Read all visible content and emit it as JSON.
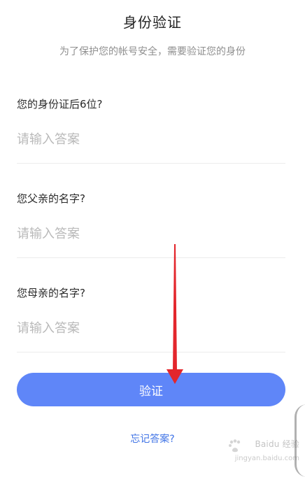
{
  "page": {
    "title": "身份验证",
    "subtitle": "为了保护您的帐号安全，需要验证您的身份"
  },
  "questions": [
    {
      "label": "您的身份证后6位?",
      "placeholder": "请输入答案"
    },
    {
      "label": "您父亲的名字?",
      "placeholder": "请输入答案"
    },
    {
      "label": "您母亲的名字?",
      "placeholder": "请输入答案"
    }
  ],
  "actions": {
    "verify": "验证",
    "forgot": "忘记答案?"
  },
  "watermark": {
    "brand": "Baidu 经验",
    "domain": "jingyan.baidu.com"
  },
  "colors": {
    "button_blue": "#5f86f8",
    "link_blue": "#3f73e6",
    "arrow_red": "#e3262c"
  }
}
